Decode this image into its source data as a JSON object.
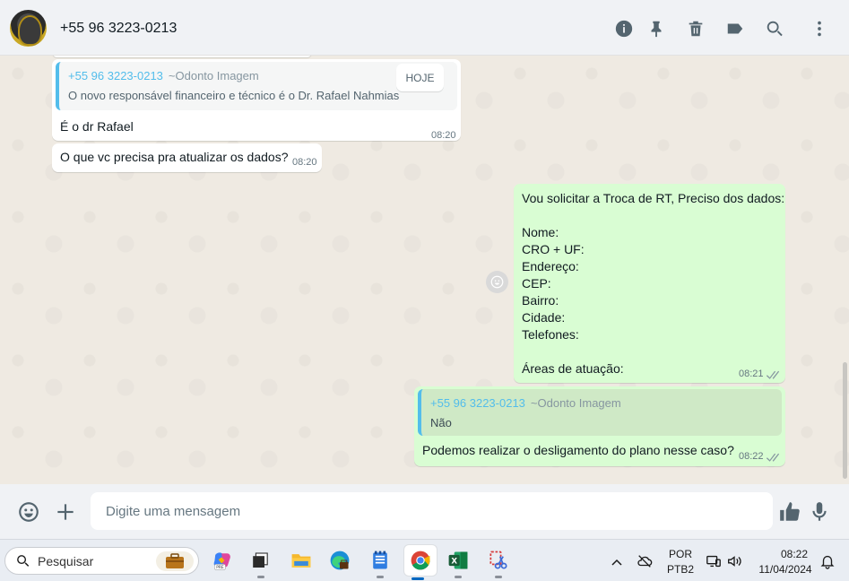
{
  "header": {
    "contact_name": "+55 96 3223-0213",
    "icons": [
      "info-icon",
      "pin-icon",
      "delete-icon",
      "label-icon",
      "search-icon",
      "menu-icon"
    ]
  },
  "messages": {
    "m1": {
      "quote_name": "+55 96 3223-0213",
      "quote_alias": "~Odonto Imagem",
      "quote_text": "O novo responsável financeiro e técnico é o Dr. Rafael Nahmias",
      "text": "É o dr Rafael",
      "time": "08:20"
    },
    "today_label": "HOJE",
    "m2": {
      "text": "O que vc precisa pra atualizar os dados?",
      "time": "08:20"
    },
    "m3": {
      "lines": [
        "Vou solicitar a Troca de RT, Preciso dos dados:",
        "",
        "Nome:",
        "CRO + UF:",
        "Endereço:",
        "CEP:",
        "Bairro:",
        "Cidade:",
        "Telefones:",
        "",
        "Áreas de atuação:"
      ],
      "time": "08:21"
    },
    "m4": {
      "quote_name": "+55 96 3223-0213",
      "quote_alias": "~Odonto Imagem",
      "quote_text": "Não",
      "text": "Podemos realizar o desligamento do plano nesse caso?",
      "time": "08:22"
    }
  },
  "composer": {
    "placeholder": "Digite uma mensagem"
  },
  "taskbar": {
    "search_text": "Pesquisar",
    "language_top": "POR",
    "language_bottom": "PTB2",
    "time": "08:22",
    "date": "11/04/2024"
  },
  "colors": {
    "outgoing_bubble": "#d9fdd3",
    "incoming_bubble": "#ffffff",
    "quote_accent": "#53bdeb",
    "chat_bg": "#efeae2"
  }
}
